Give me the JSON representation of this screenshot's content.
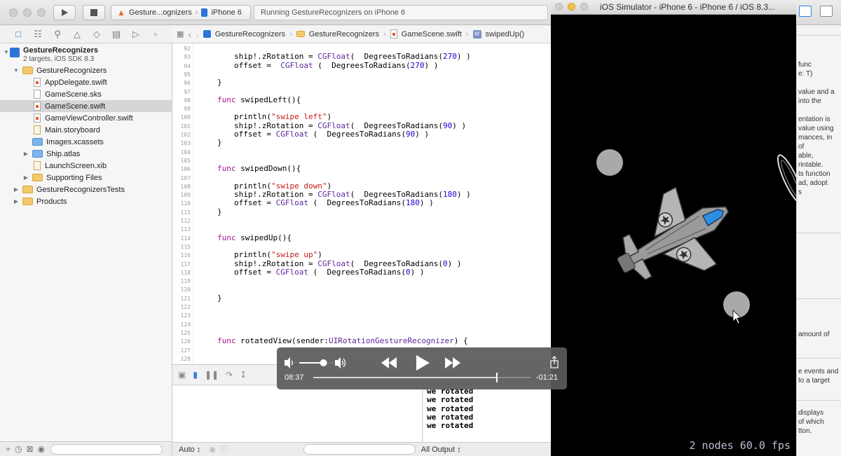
{
  "toolbar": {
    "scheme_target": "Gesture...ognizers",
    "scheme_device": "iPhone 6",
    "status_text": "Running GestureRecognizers on iPhone 6"
  },
  "jumpbar": {
    "crumbs": [
      "GestureRecognizers",
      "GestureRecognizers",
      "GameScene.swift",
      "swipedUp()"
    ]
  },
  "navigator": {
    "project_name": "GestureRecognizers",
    "project_sub": "2 targets, iOS SDK 8.3",
    "items": [
      {
        "label": "GestureRecognizers"
      },
      {
        "label": "AppDelegate.swift"
      },
      {
        "label": "GameScene.sks"
      },
      {
        "label": "GameScene.swift"
      },
      {
        "label": "GameViewController.swift"
      },
      {
        "label": "Main.storyboard"
      },
      {
        "label": "Images.xcassets"
      },
      {
        "label": "Ship.atlas"
      },
      {
        "label": "LaunchScreen.xib"
      },
      {
        "label": "Supporting Files"
      },
      {
        "label": "GestureRecognizersTests"
      },
      {
        "label": "Products"
      }
    ]
  },
  "editor": {
    "line_numbers": [
      "92",
      "93",
      "94",
      "95",
      "96",
      "97",
      "98",
      "99",
      "100",
      "101",
      "102",
      "103",
      "104",
      "105",
      "106",
      "107",
      "108",
      "109",
      "110",
      "111",
      "112",
      "113",
      "114",
      "115",
      "116",
      "117",
      "118",
      "119",
      "120",
      "121",
      "122",
      "123",
      "124",
      "125",
      "126",
      "127",
      "128",
      "129"
    ],
    "code_lines": [
      {
        "n": 1,
        "text": "ship!.zRotation = CGFloat(  DegreesToRadians(270) )"
      },
      {
        "n": 2,
        "text": "offset =  CGFloat (  DegreesToRadians(270) )"
      },
      {
        "n": 4,
        "text": "}"
      },
      {
        "n": 6,
        "text": "func swipedLeft(){"
      },
      {
        "n": 8,
        "text": "println(\"swipe left\")"
      },
      {
        "n": 9,
        "text": "ship!.zRotation = CGFloat(  DegreesToRadians(90) )"
      },
      {
        "n": 10,
        "text": "offset = CGFloat (  DegreesToRadians(90) )"
      },
      {
        "n": 11,
        "text": "}"
      },
      {
        "n": 14,
        "text": "func swipedDown(){"
      },
      {
        "n": 16,
        "text": "println(\"swipe down\")"
      },
      {
        "n": 17,
        "text": "ship!.zRotation = CGFloat(  DegreesToRadians(180) )"
      },
      {
        "n": 18,
        "text": "offset = CGFloat (  DegreesToRadians(180) )"
      },
      {
        "n": 19,
        "text": "}"
      },
      {
        "n": 22,
        "text": "func swipedUp(){"
      },
      {
        "n": 24,
        "text": "println(\"swipe up\")"
      },
      {
        "n": 25,
        "text": "ship!.zRotation = CGFloat(  DegreesToRadians(0) )"
      },
      {
        "n": 26,
        "text": "offset = CGFloat (  DegreesToRadians(0) )"
      },
      {
        "n": 29,
        "text": "}"
      },
      {
        "n": 34,
        "text": "func rotatedView(sender:UIRotationGestureRecognizer) {"
      }
    ]
  },
  "debug": {
    "console_lines": [
      "we rotated",
      "we rotated",
      "we rotated",
      "we rotated",
      "we rotated"
    ],
    "variables_mode": "Auto ↕",
    "output_mode": "All Output ↕"
  },
  "inspector": {
    "lines_a": [
      "func",
      "e: T)",
      "",
      "value and a",
      "into the",
      "",
      "entation is",
      "value using",
      "mances, in",
      "of",
      "able,",
      "rintable.",
      "ts function",
      "ad, adopt",
      "s"
    ],
    "lines_b": [
      "amount of"
    ],
    "lines_c": [
      "e events and",
      "to a target"
    ],
    "lines_d": [
      "displays",
      "of which",
      "tton."
    ]
  },
  "simulator": {
    "title": "iOS Simulator - iPhone 6 - iPhone 6 / iOS 8.3...",
    "stats": "2 nodes 60.0 fps"
  },
  "media": {
    "elapsed": "08:37",
    "remaining": "-01:21",
    "progress": 0.845,
    "volume": 0.72
  }
}
